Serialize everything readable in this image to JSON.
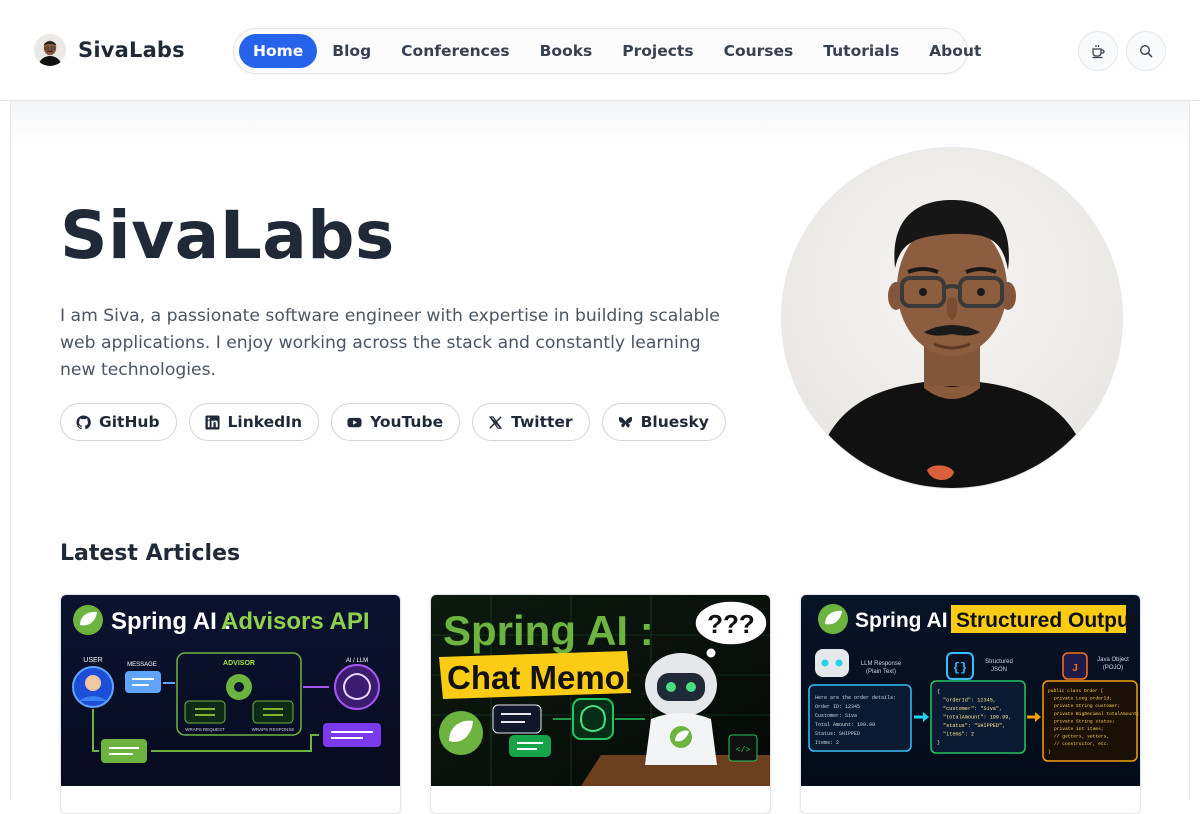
{
  "header": {
    "brand_name": "SivaLabs",
    "nav": [
      {
        "label": "Home",
        "active": true
      },
      {
        "label": "Blog"
      },
      {
        "label": "Conferences"
      },
      {
        "label": "Books"
      },
      {
        "label": "Projects"
      },
      {
        "label": "Courses"
      },
      {
        "label": "Tutorials"
      },
      {
        "label": "About"
      }
    ],
    "icons": [
      "theme-coffee-icon",
      "search-icon"
    ]
  },
  "hero": {
    "title": "SivaLabs",
    "description": "I am Siva, a passionate software engineer with expertise in building scalable web applications. I enjoy working across the stack and constantly learning new technologies.",
    "socials": [
      {
        "label": "GitHub",
        "icon": "github-icon"
      },
      {
        "label": "LinkedIn",
        "icon": "linkedin-icon"
      },
      {
        "label": "YouTube",
        "icon": "youtube-icon"
      },
      {
        "label": "Twitter",
        "icon": "x-twitter-icon"
      },
      {
        "label": "Bluesky",
        "icon": "bluesky-butterfly-icon"
      }
    ]
  },
  "articles": {
    "title": "Latest Articles",
    "cards": [
      {
        "headline_a": "Spring AI : ",
        "headline_b": "Advisors API",
        "labels": {
          "user": "USER",
          "message": "MESSAGE",
          "advisor": "ADVISOR",
          "ai": "AI / LLM",
          "req": "WRAPS REQUEST",
          "res": "WRAPS RESPONSE"
        }
      },
      {
        "headline_a": "Spring AI :",
        "headline_b": "Chat Memory",
        "bubble": "???"
      },
      {
        "headline_a": "Spring AI : ",
        "headline_b": "Structured Output",
        "labels": {
          "llm": "LLM Response",
          "llm2": "(Plain Text)",
          "json": "Structured",
          "json2": "JSON",
          "pojo": "Java Object",
          "pojo2": "(POJO)",
          "plain": [
            "Here are the order details:",
            "Order ID: 12345",
            "Customer: Siva",
            "Total Amount: 199.99",
            "Status: SHIPPED",
            "Items: 2"
          ],
          "jsonlines": [
            "{",
            "\"orderId\": 12345,",
            "\"customer\": \"Siva\",",
            "\"totalAmount\": 199.99,",
            "\"status\": \"SHIPPED\",",
            "\"items\": 2",
            "}"
          ],
          "javalines": [
            "public class Order {",
            "private Long orderId;",
            "private String customer;",
            "private BigDecimal totalAmount;",
            "private String status;",
            "private int items;",
            "// getters, setters,",
            "// constructor, etc.",
            "}"
          ]
        }
      }
    ]
  },
  "colors": {
    "accent": "#2563eb",
    "spring_green": "#6db33f",
    "text_dark": "#1f2937",
    "text_muted": "#4b5563"
  }
}
